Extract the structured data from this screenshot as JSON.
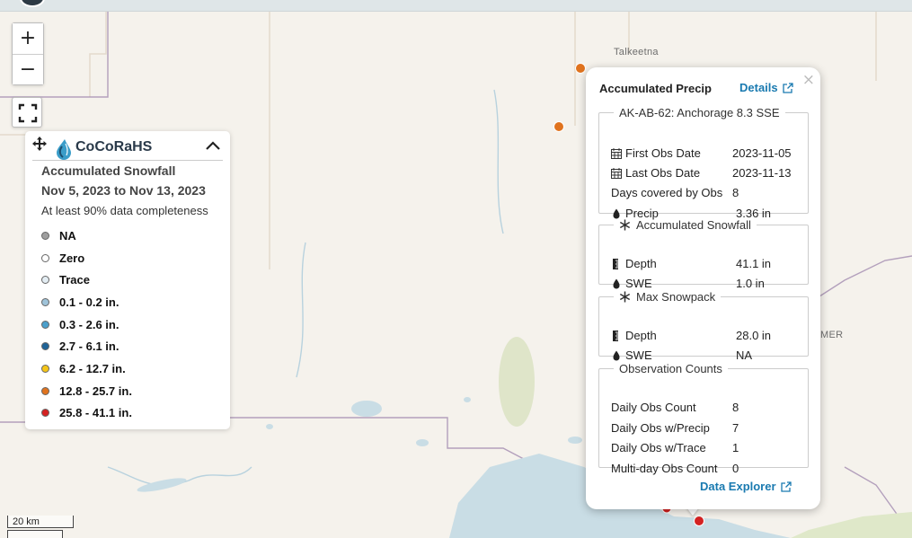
{
  "map": {
    "place_labels": [
      "Talkeetna",
      "MER"
    ],
    "scale_label": "20 km",
    "colors": {
      "land": "#f5f2ec",
      "water": "#c9dde5",
      "border": "#9a7aa8",
      "road": "#e0d6c6"
    }
  },
  "controls": {
    "zoom_in": "+",
    "zoom_out": "−",
    "fullscreen_icon": "fullscreen-icon"
  },
  "legend": {
    "brand": "CoCoRaHS",
    "title": "Accumulated Snowfall",
    "date_range": "Nov 5, 2023 to Nov 13, 2023",
    "note": "At least 90% data completeness",
    "items": [
      {
        "label": "NA",
        "color": "#9e9e9e"
      },
      {
        "label": "Zero",
        "color": "#ffffff"
      },
      {
        "label": "Trace",
        "color": "#e3edf3"
      },
      {
        "label": "0.1 - 0.2 in.",
        "color": "#9fc3d9"
      },
      {
        "label": "0.3 - 2.6 in.",
        "color": "#4b9fcb"
      },
      {
        "label": "2.7 - 6.1 in.",
        "color": "#1f6397"
      },
      {
        "label": "6.2 - 12.7 in.",
        "color": "#f5c518"
      },
      {
        "label": "12.8 - 25.7 in.",
        "color": "#e0731e"
      },
      {
        "label": "25.8 - 41.1 in.",
        "color": "#d42222"
      }
    ]
  },
  "popup": {
    "title": "Accumulated Precip",
    "details_link": "Details",
    "close": "×",
    "station": {
      "name": "AK-AB-62: Anchorage 8.3 SSE",
      "first_obs_label": "First Obs Date",
      "first_obs_value": "2023-11-05",
      "last_obs_label": "Last Obs Date",
      "last_obs_value": "2023-11-13",
      "days_label": "Days covered by Obs",
      "days_value": "8",
      "precip_label": "Precip",
      "precip_value": "3.36 in"
    },
    "snowfall": {
      "title": "Accumulated Snowfall",
      "depth_label": "Depth",
      "depth_value": "41.1 in",
      "swe_label": "SWE",
      "swe_value": "1.0 in"
    },
    "snowpack": {
      "title": "Max Snowpack",
      "depth_label": "Depth",
      "depth_value": "28.0 in",
      "swe_label": "SWE",
      "swe_value": "NA"
    },
    "counts": {
      "title": "Observation Counts",
      "daily_label": "Daily Obs Count",
      "daily_value": "8",
      "precip_label": "Daily Obs w/Precip",
      "precip_value": "7",
      "trace_label": "Daily Obs w/Trace",
      "trace_value": "1",
      "multi_label": "Multi-day Obs Count",
      "multi_value": "0"
    },
    "data_explorer": "Data Explorer"
  }
}
